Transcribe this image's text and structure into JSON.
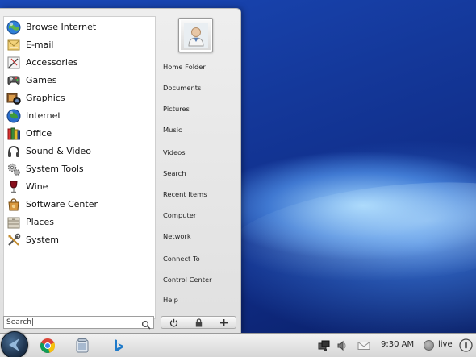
{
  "apps": [
    {
      "label": "Browse Internet",
      "icon": "globe-browser-icon"
    },
    {
      "label": "E-mail",
      "icon": "mail-icon"
    },
    {
      "label": "Accessories",
      "icon": "accessories-icon"
    },
    {
      "label": "Games",
      "icon": "gamepad-icon"
    },
    {
      "label": "Graphics",
      "icon": "graphics-icon"
    },
    {
      "label": "Internet",
      "icon": "globe-icon"
    },
    {
      "label": "Office",
      "icon": "office-icon"
    },
    {
      "label": "Sound & Video",
      "icon": "headphones-icon"
    },
    {
      "label": "System Tools",
      "icon": "gears-icon"
    },
    {
      "label": "Wine",
      "icon": "wine-glass-icon"
    },
    {
      "label": "Software Center",
      "icon": "software-center-icon"
    },
    {
      "label": "Places",
      "icon": "places-icon"
    },
    {
      "label": "System",
      "icon": "tools-icon"
    }
  ],
  "places": [
    "Home Folder",
    "Documents",
    "Pictures",
    "Music",
    "Videos",
    "Search",
    "Recent Items",
    "Computer",
    "Network",
    "Connect To",
    "Control Center",
    "Help"
  ],
  "search": {
    "value": "Search|"
  },
  "session_icons": [
    "power-icon",
    "lock-icon",
    "plus-icon"
  ],
  "taskbar": {
    "apps": [
      "chrome-icon",
      "file-manager-icon",
      "bing-icon"
    ],
    "tray": [
      "network-icon",
      "volume-icon",
      "mail-icon"
    ],
    "clock": "9:30 AM",
    "user": "live"
  },
  "colors": {
    "desktop_blue": "#14389a",
    "menu_bg": "#e8e8e8",
    "taskbar_bg": "#e4e4e4"
  }
}
